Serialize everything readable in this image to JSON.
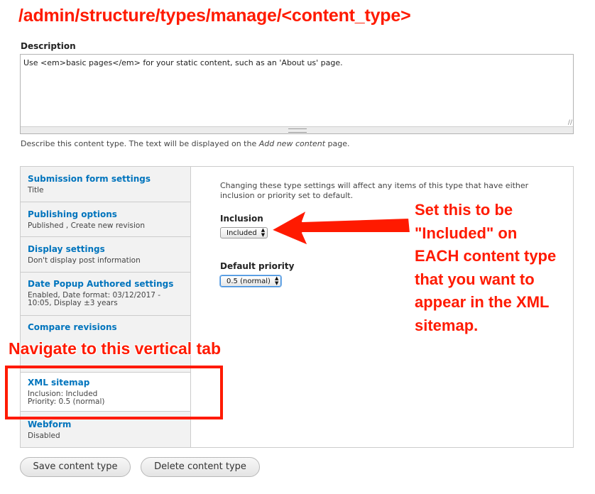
{
  "annotations": {
    "heading": "/admin/structure/types/manage/<content_type>",
    "navigate_note": "Navigate to this vertical tab",
    "set_note_lines": [
      "Set this to be",
      "\"Included\" on",
      "EACH content type",
      "that you want to",
      "appear in the XML",
      "sitemap."
    ],
    "color": "#ff1a00"
  },
  "description": {
    "label": "Description",
    "value": "Use <em>basic pages</em> for your static content, such as an 'About us' page.",
    "help_before": "Describe this content type. The text will be displayed on the ",
    "help_em": "Add new content",
    "help_after": " page."
  },
  "vertical_tabs": [
    {
      "title": "Submission form settings",
      "summary": [
        "Title"
      ]
    },
    {
      "title": "Publishing options",
      "summary": [
        "Published , Create new revision"
      ]
    },
    {
      "title": "Display settings",
      "summary": [
        "Don't display post information"
      ]
    },
    {
      "title": "Date Popup Authored settings",
      "summary": [
        "Enabled, Date format: 03/12/2017 -",
        "10:05, Display ±3 years"
      ]
    },
    {
      "title": "Compare revisions",
      "summary": []
    },
    {
      "title": "XML sitemap",
      "summary": [
        "Inclusion: Included",
        "Priority: 0.5 (normal)"
      ],
      "active": true
    },
    {
      "title": "Webform",
      "summary": [
        "Disabled"
      ]
    }
  ],
  "pane": {
    "intro": "Changing these type settings will affect any items of this type that have either inclusion or priority set to default.",
    "inclusion_label": "Inclusion",
    "inclusion_value": "Included",
    "priority_label": "Default priority",
    "priority_value": "0.5 (normal)"
  },
  "buttons": {
    "save": "Save content type",
    "delete": "Delete content type"
  },
  "link_color": "#0074bd"
}
